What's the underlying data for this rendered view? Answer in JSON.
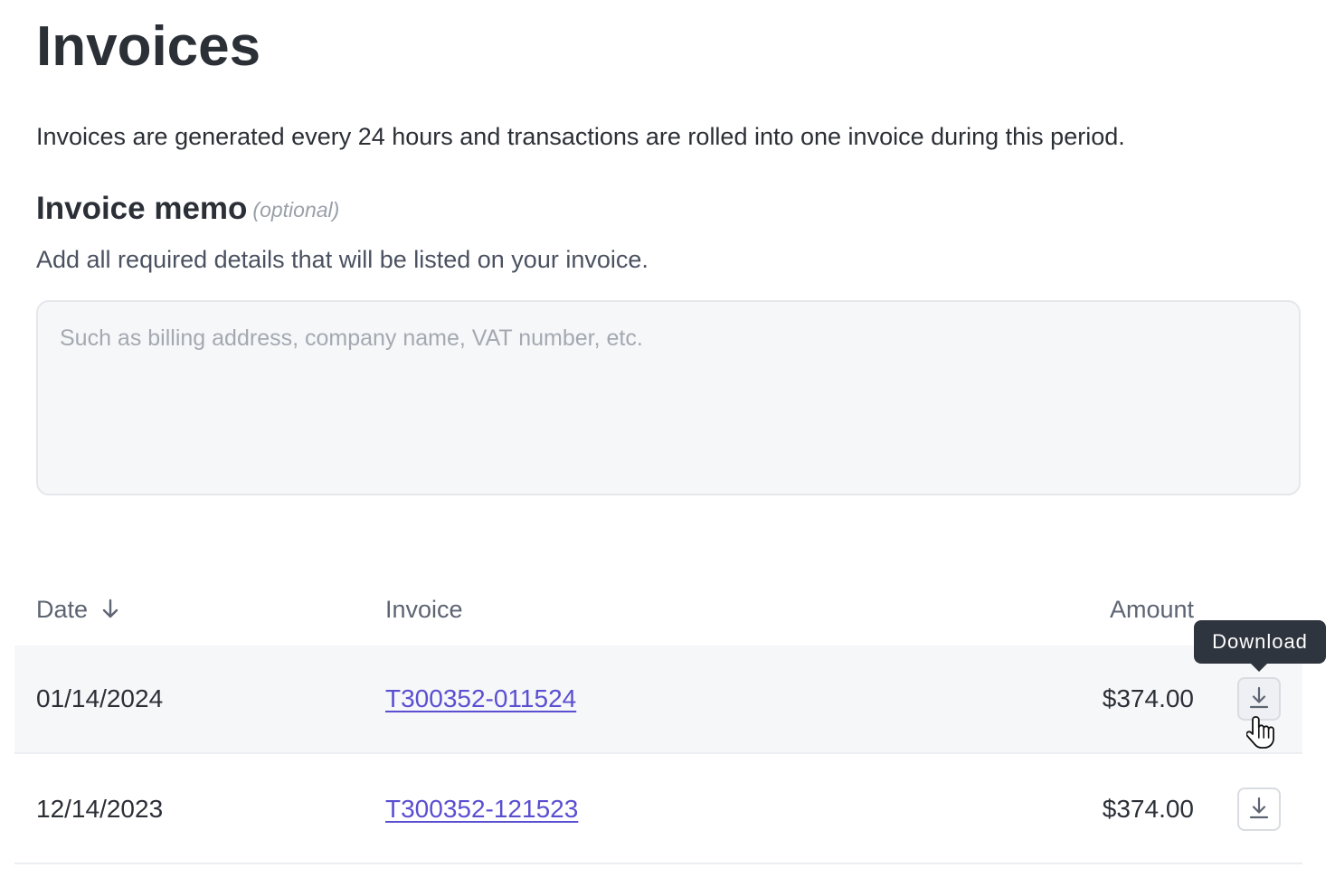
{
  "header": {
    "title": "Invoices",
    "description": "Invoices are generated every 24 hours and transactions are rolled into one invoice during this period."
  },
  "memo": {
    "heading": "Invoice memo",
    "optional_label": "(optional)",
    "help_text": "Add all required details that will be listed on your invoice.",
    "value": "",
    "placeholder": "Such as billing address, company name, VAT number, etc."
  },
  "table": {
    "columns": {
      "date": "Date",
      "invoice": "Invoice",
      "amount": "Amount"
    },
    "sort_icon": "arrow-down-icon",
    "rows": [
      {
        "date": "01/14/2024",
        "invoice": "T300352-011524",
        "amount": "$374.00"
      },
      {
        "date": "12/14/2023",
        "invoice": "T300352-121523",
        "amount": "$374.00"
      }
    ]
  },
  "tooltip": {
    "label": "Download"
  },
  "icons": {
    "download": "download-icon",
    "cursor": "pointer-hand-cursor"
  },
  "colors": {
    "link": "#5b4fd1",
    "tooltip_bg": "#2f353e",
    "row_hover_bg": "#f6f7f9"
  }
}
